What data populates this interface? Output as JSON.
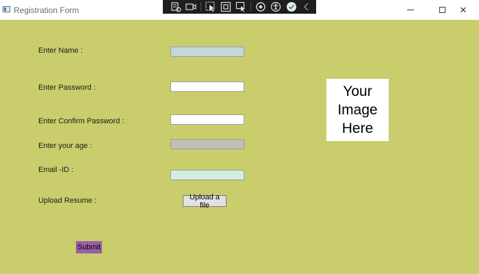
{
  "window": {
    "title": "Registration Form",
    "minimize_glyph": "",
    "maximize_glyph": "",
    "close_glyph": "✕"
  },
  "debug_toolbar": {
    "icons": [
      "live-visual-tree-icon",
      "video-camera-icon",
      "select-element-icon",
      "display-layout-adorners-icon",
      "track-focus-icon",
      "hot-reload-icon",
      "accessibility-icon",
      "checkmark-icon",
      "collapse-chevron-icon"
    ]
  },
  "form": {
    "background": "#c9cd6b",
    "name_label": "Enter Name :",
    "name_value": "",
    "name_bg": "#c2d9dc",
    "password_label": "Enter Password :",
    "password_value": "",
    "password_bg": "#ffffff",
    "confirm_password_label": "Enter Confirm Password :",
    "confirm_password_value": "",
    "confirm_password_bg": "#ffffff",
    "age_label": "Enter your age :",
    "age_value": "",
    "age_bg": "#bdc0b5",
    "email_label": "Email -ID :",
    "email_value": "",
    "email_bg": "#d0eee2",
    "resume_label": "Upload Resume :",
    "upload_button": "Upload a file",
    "submit_button": "Submit",
    "submit_bg": "#9b5fa6",
    "image_text": "Your\nImage\nHere"
  }
}
